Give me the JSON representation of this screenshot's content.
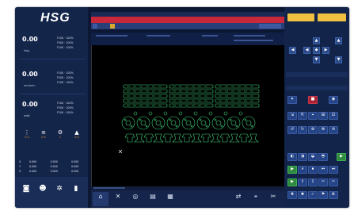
{
  "brand": {
    "logo": "HSG"
  },
  "speed_panels": [
    {
      "value": "0.00",
      "unit": "Hop",
      "lines": [
        "F100 · 100%",
        "F500 · 100%",
        "F100 · 100%"
      ]
    },
    {
      "value": "0.00",
      "unit": "mm/min",
      "lines": [
        "F100 · 100%",
        "F500 · 100%",
        "F100 · 100%"
      ]
    },
    {
      "value": "0.00",
      "unit": "watt",
      "lines": [
        "F100 · 100%",
        "F500 · 100%",
        "F100 · 100%"
      ]
    }
  ],
  "controls": [
    {
      "icon": "laser-icon",
      "glyph": "⋮",
      "label": "",
      "value": "0.0"
    },
    {
      "icon": "stack-icon",
      "glyph": "≡",
      "label": "",
      "value": "0.0"
    },
    {
      "icon": "gear-icon",
      "glyph": "⚙",
      "label": "",
      "value": "1"
    },
    {
      "icon": "nozzle-icon",
      "glyph": "▲",
      "label": "",
      "value": "0.0"
    }
  ],
  "coord_table": {
    "headers": [
      "",
      "",
      "",
      ""
    ],
    "rows": [
      [
        "X",
        "0.000",
        "0.000",
        "0.000"
      ],
      [
        "Y",
        "0.000",
        "0.000",
        "0.000"
      ],
      [
        "Z",
        "0.000",
        "0.000",
        "0.000"
      ]
    ]
  },
  "bottom_left": [
    {
      "icon": "camera-icon",
      "glyph": "◙",
      "label": ""
    },
    {
      "icon": "user-icon",
      "glyph": "☻",
      "label": ""
    },
    {
      "icon": "settings-icon",
      "glyph": "✲",
      "label": ""
    },
    {
      "icon": "power-icon",
      "glyph": "▮",
      "label": ""
    }
  ],
  "window": {
    "title": "",
    "right_text": ""
  },
  "tabs": [
    "",
    ""
  ],
  "bottom_center": [
    {
      "icon": "home-icon",
      "glyph": "⌂",
      "label": ""
    },
    {
      "icon": "tools-icon",
      "glyph": "✕",
      "label": ""
    },
    {
      "icon": "layers-icon",
      "glyph": "◎",
      "label": ""
    },
    {
      "icon": "document-icon",
      "glyph": "▤",
      "label": ""
    },
    {
      "icon": "nest-icon",
      "glyph": "▦",
      "label": ""
    },
    {
      "icon": "sort-icon",
      "glyph": "⇄",
      "label": ""
    },
    {
      "icon": "scan-icon",
      "glyph": "⌖",
      "label": ""
    },
    {
      "icon": "tool2-icon",
      "glyph": "✂",
      "label": ""
    }
  ],
  "right_panel": {
    "top_buttons": [
      "",
      ""
    ],
    "section_label": ""
  },
  "colors": {
    "accent_gold": "#f0c040",
    "accent_blue": "#2b4a8a",
    "part_green": "#3fd07a",
    "alert_red": "#c8283a"
  }
}
